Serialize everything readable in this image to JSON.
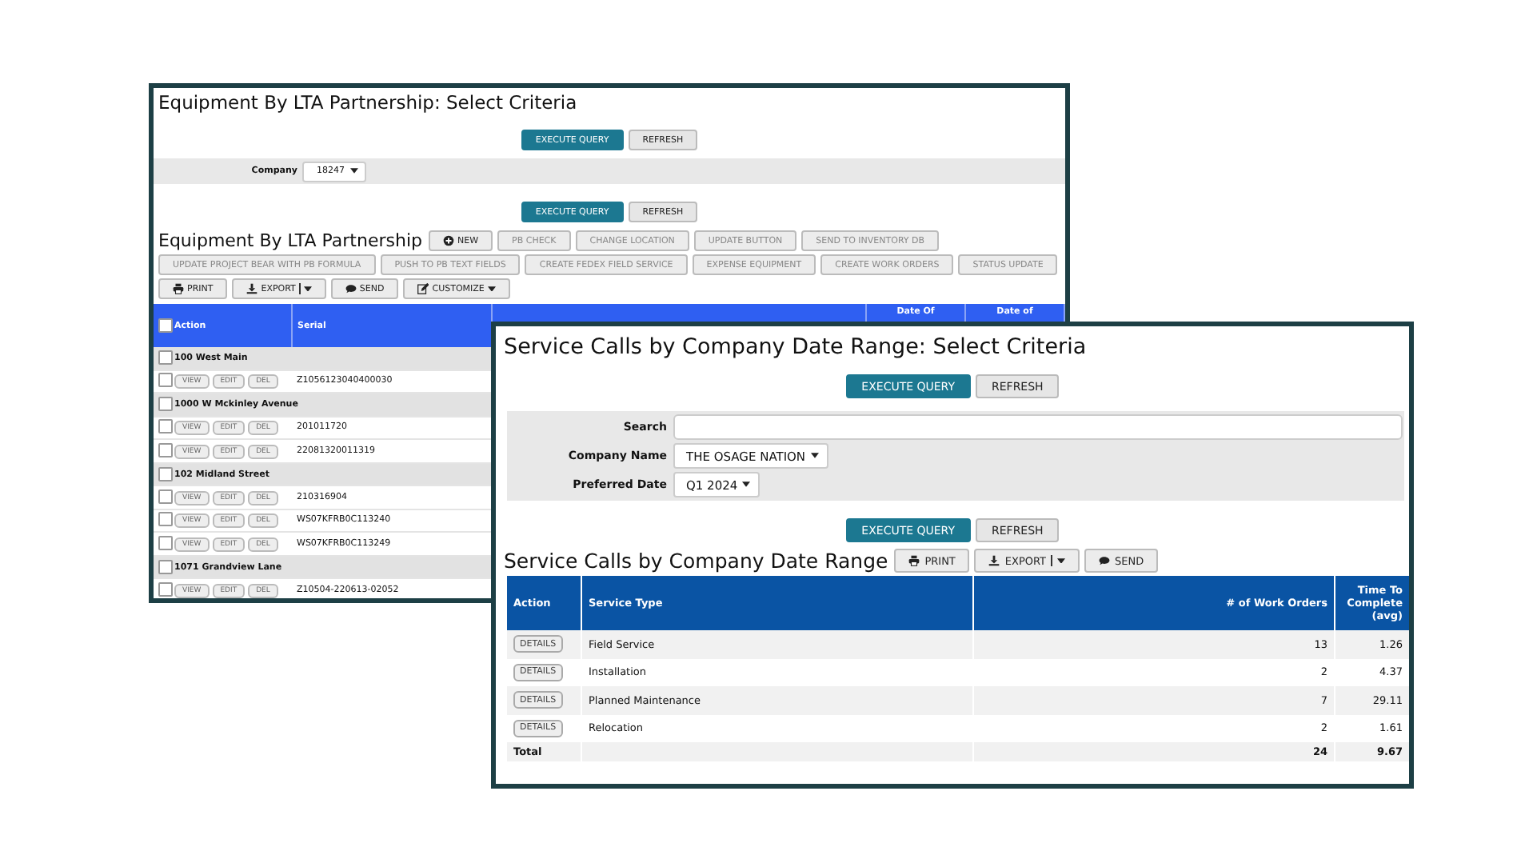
{
  "equipment_window": {
    "title": "Equipment By LTA Partnership: Select Criteria",
    "query_buttons": [
      {
        "label": "EXECUTE QUERY",
        "kind": "primary"
      },
      {
        "label": "REFRESH",
        "kind": "secondary"
      }
    ],
    "criteria": [
      {
        "label": "Company",
        "kind": "select",
        "value": "18247"
      }
    ],
    "query_buttons_bottom": [
      {
        "label": "EXECUTE QUERY",
        "kind": "primary"
      },
      {
        "label": "REFRESH",
        "kind": "secondary"
      }
    ],
    "report_title": "Equipment By LTA Partnership",
    "toolbar": [
      {
        "label": "NEW",
        "kind": "new",
        "disabled": false
      },
      {
        "label": "PB CHECK",
        "kind": "plain",
        "disabled": true
      },
      {
        "label": "CHANGE LOCATION",
        "kind": "plain",
        "disabled": true
      },
      {
        "label": "UPDATE BUTTON",
        "kind": "plain",
        "disabled": true
      },
      {
        "label": "SEND TO INVENTORY DB",
        "kind": "plain",
        "disabled": true
      },
      {
        "label": "UPDATE PROJECT BEAR WITH PB FORMULA",
        "kind": "plain",
        "disabled": true
      },
      {
        "label": "PUSH TO PB TEXT FIELDS",
        "kind": "plain",
        "disabled": true
      },
      {
        "label": "CREATE FEDEX FIELD SERVICE",
        "kind": "plain",
        "disabled": true
      },
      {
        "label": "EXPENSE EQUIPMENT",
        "kind": "plain",
        "disabled": true
      },
      {
        "label": "CREATE WORK ORDERS",
        "kind": "plain",
        "disabled": true
      },
      {
        "label": "STATUS UPDATE",
        "kind": "plain",
        "disabled": true
      },
      {
        "label": "PRINT",
        "kind": "print",
        "disabled": false
      },
      {
        "label": "EXPORT",
        "kind": "export",
        "disabled": false
      },
      {
        "label": "SEND",
        "kind": "send",
        "disabled": false
      },
      {
        "label": "CUSTOMIZE",
        "kind": "customize",
        "disabled": false
      }
    ],
    "table": {
      "select_all_checked": false,
      "columns": [
        "Action",
        "Serial",
        "Date Of",
        "Date of"
      ],
      "rows": [
        {
          "kind": "group",
          "label": "100 West Main",
          "checked": false
        },
        {
          "kind": "item",
          "checked": false,
          "actions": [
            "VIEW",
            "EDIT",
            "DEL"
          ],
          "serial": "Z1056123040400030"
        },
        {
          "kind": "group",
          "label": "1000 W Mckinley Avenue",
          "checked": false
        },
        {
          "kind": "item",
          "checked": false,
          "actions": [
            "VIEW",
            "EDIT",
            "DEL"
          ],
          "serial": "201011720"
        },
        {
          "kind": "item",
          "checked": false,
          "actions": [
            "VIEW",
            "EDIT",
            "DEL"
          ],
          "serial": "22081320011319"
        },
        {
          "kind": "group",
          "label": "102 Midland Street",
          "checked": false
        },
        {
          "kind": "item",
          "checked": false,
          "actions": [
            "VIEW",
            "EDIT",
            "DEL"
          ],
          "serial": "210316904"
        },
        {
          "kind": "item",
          "checked": false,
          "actions": [
            "VIEW",
            "EDIT",
            "DEL"
          ],
          "serial": "WS07KFRB0C113240"
        },
        {
          "kind": "item",
          "checked": false,
          "actions": [
            "VIEW",
            "EDIT",
            "DEL"
          ],
          "serial": "WS07KFRB0C113249"
        },
        {
          "kind": "group",
          "label": "1071 Grandview Lane",
          "checked": false
        },
        {
          "kind": "item",
          "checked": false,
          "actions": [
            "VIEW",
            "EDIT",
            "DEL"
          ],
          "serial": "Z10504-220613-02052"
        }
      ]
    }
  },
  "service_window": {
    "title": "Service Calls by Company Date Range: Select Criteria",
    "query_buttons": [
      {
        "label": "EXECUTE QUERY",
        "kind": "primary"
      },
      {
        "label": "REFRESH",
        "kind": "secondary"
      }
    ],
    "criteria": [
      {
        "label": "Search",
        "kind": "text"
      },
      {
        "label": "Company Name",
        "kind": "select",
        "value": "THE OSAGE NATION"
      },
      {
        "label": "Preferred Date",
        "kind": "select",
        "value": "Q1 2024"
      }
    ],
    "query_buttons_bottom": [
      {
        "label": "EXECUTE QUERY",
        "kind": "primary"
      },
      {
        "label": "REFRESH",
        "kind": "secondary"
      }
    ],
    "report_title": "Service Calls by Company Date Range",
    "toolbar": [
      {
        "label": "PRINT",
        "kind": "print",
        "disabled": false
      },
      {
        "label": "EXPORT",
        "kind": "export",
        "disabled": false
      },
      {
        "label": "SEND",
        "kind": "send",
        "disabled": false
      }
    ],
    "table": {
      "columns": [
        "Action",
        "Service Type",
        "# of Work Orders",
        "Time To Complete (avg)"
      ],
      "rows": [
        {
          "action": "DETAILS",
          "service_type": "Field Service",
          "work_orders": "13",
          "time": "1.26"
        },
        {
          "action": "DETAILS",
          "service_type": "Installation",
          "work_orders": "2",
          "time": "4.37"
        },
        {
          "action": "DETAILS",
          "service_type": "Planned Maintenance",
          "work_orders": "7",
          "time": "29.11"
        },
        {
          "action": "DETAILS",
          "service_type": "Relocation",
          "work_orders": "2",
          "time": "1.61"
        }
      ],
      "total": {
        "label": "Total",
        "work_orders": "24",
        "time": "9.67"
      }
    }
  }
}
